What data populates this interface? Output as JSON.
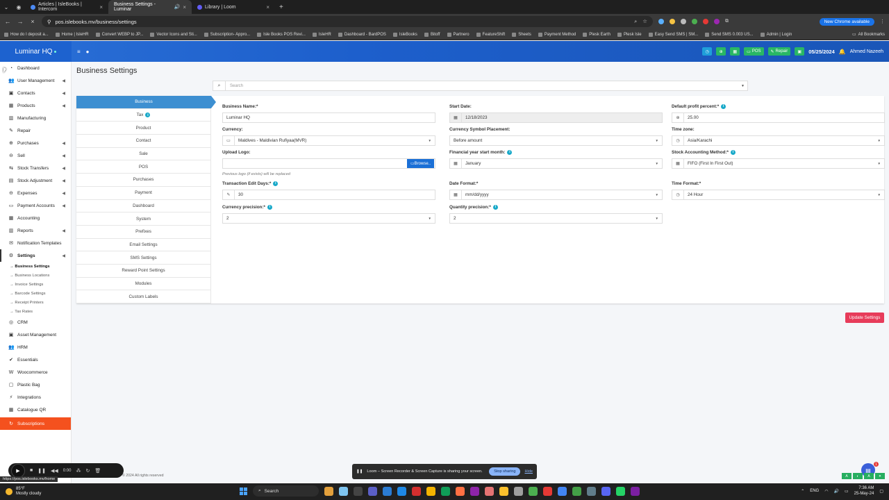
{
  "browser": {
    "tabs": [
      {
        "title": "Articles | IsleBooks | Intercom",
        "active": false
      },
      {
        "title": "Business Settings - Luminar",
        "active": true
      },
      {
        "title": "Library | Loom",
        "active": false
      }
    ],
    "url": "pos.islebooks.mv/business/settings",
    "new_chrome": "New Chrome available",
    "bookmarks": [
      "How do I deposit a...",
      "Home | IsleHR",
      "Convert WEBP to JP...",
      "Vector Icons and Sti...",
      "Subscription- Appro...",
      "Isle Books POS Revi...",
      "IsleHR",
      "Dashboard - BardPOS",
      "IsleBooks",
      "Bitoff",
      "Partnero",
      "FeatureShift",
      "Sheets",
      "Payment Method",
      "Plesk Earth",
      "Plesk Isle",
      "Easy Send SMS | SM...",
      "Send SMS 0.003 US...",
      "Admin | Login"
    ],
    "all_bookmarks": "All Bookmarks"
  },
  "header": {
    "brand": "Luminar HQ",
    "pos_label": "POS",
    "repair_label": "Repair",
    "date": "05/25/2024",
    "user": "Ahmed Nazeeh"
  },
  "sidebar": {
    "items": [
      {
        "label": "Dashboard",
        "icon": "dashboard-icon",
        "arrow": false
      },
      {
        "label": "User Management",
        "icon": "users-icon",
        "arrow": true
      },
      {
        "label": "Contacts",
        "icon": "contacts-icon",
        "arrow": true
      },
      {
        "label": "Products",
        "icon": "cubes-icon",
        "arrow": true
      },
      {
        "label": "Manufacturing",
        "icon": "industry-icon",
        "arrow": false
      },
      {
        "label": "Repair",
        "icon": "wrench-icon",
        "arrow": false
      },
      {
        "label": "Purchases",
        "icon": "purchase-icon",
        "arrow": true
      },
      {
        "label": "Sell",
        "icon": "sell-icon",
        "arrow": true
      },
      {
        "label": "Stock Transfers",
        "icon": "truck-icon",
        "arrow": true
      },
      {
        "label": "Stock Adjustment",
        "icon": "database-icon",
        "arrow": true
      },
      {
        "label": "Expenses",
        "icon": "minus-circle-icon",
        "arrow": true
      },
      {
        "label": "Payment Accounts",
        "icon": "money-icon",
        "arrow": true
      },
      {
        "label": "Accounting",
        "icon": "calculator-icon",
        "arrow": false
      },
      {
        "label": "Reports",
        "icon": "chart-icon",
        "arrow": true
      },
      {
        "label": "Notification Templates",
        "icon": "envelope-icon",
        "arrow": false
      },
      {
        "label": "Settings",
        "icon": "gear-icon",
        "arrow": true,
        "active": true
      }
    ],
    "settings_sub": [
      {
        "label": "→ Business Settings",
        "active": true
      },
      {
        "label": "→ Business Locations"
      },
      {
        "label": "→ Invoice Settings"
      },
      {
        "label": "→ Barcode Settings"
      },
      {
        "label": "→ Receipt Printers"
      },
      {
        "label": "→ Tax Rates"
      }
    ],
    "items_after": [
      {
        "label": "CRM",
        "icon": "crm-icon"
      },
      {
        "label": "Asset Management",
        "icon": "boxes-icon"
      },
      {
        "label": "HRM",
        "icon": "hrm-icon"
      },
      {
        "label": "Essentials",
        "icon": "check-circle-icon"
      },
      {
        "label": "Woocommerce",
        "icon": "woocommerce-icon"
      },
      {
        "label": "Plastic Bag",
        "icon": "bag-icon"
      },
      {
        "label": "Integrations",
        "icon": "plug-icon"
      },
      {
        "label": "Catalogue QR",
        "icon": "qr-icon"
      },
      {
        "label": "Subscriptions",
        "icon": "refresh-icon"
      }
    ]
  },
  "page": {
    "title": "Business Settings",
    "search_placeholder": "Search",
    "vertical_tabs": [
      "Business",
      "Tax",
      "Product",
      "Contact",
      "Sale",
      "POS",
      "Purchases",
      "Payment",
      "Dashboard",
      "System",
      "Prefixes",
      "Email Settings",
      "SMS Settings",
      "Reward Point Settings",
      "Modules",
      "Custom Labels"
    ],
    "form": {
      "business_name": {
        "label": "Business Name:*",
        "value": "Luminar HQ"
      },
      "start_date": {
        "label": "Start Date:",
        "value": "12/18/2023"
      },
      "profit_percent": {
        "label": "Default profit percent:*",
        "value": "25.00"
      },
      "currency": {
        "label": "Currency:",
        "value": "Maldives - Maldivian Rufiyaa(MVR)"
      },
      "symbol_placement": {
        "label": "Currency Symbol Placement:",
        "value": "Before amount"
      },
      "time_zone": {
        "label": "Time zone:",
        "value": "Asia/Karachi"
      },
      "upload_logo": {
        "label": "Upload Logo:",
        "browse": "Browse..",
        "help": "Previous logo (if exists) will be replaced"
      },
      "fy_start": {
        "label": "Financial year start month:",
        "value": "January"
      },
      "stock_method": {
        "label": "Stock Accounting Method:*",
        "value": "FIFO (First In First Out)"
      },
      "edit_days": {
        "label": "Transaction Edit Days:*",
        "value": "30"
      },
      "date_format": {
        "label": "Date Format:*",
        "value": "mm/dd/yyyy"
      },
      "time_format": {
        "label": "Time Format:*",
        "value": "24 Hour"
      },
      "currency_precision": {
        "label": "Currency precision:*",
        "value": "2"
      },
      "quantity_precision": {
        "label": "Quantity precision:*",
        "value": "2"
      }
    },
    "update_button": "Update Settings",
    "copyright": "© 2024 All rights reserved"
  },
  "overlays": {
    "loom_time": "0:00",
    "loom_msg": "Loom – Screen Recorder & Screen Capture is sharing your screen.",
    "stop_sharing": "Stop sharing",
    "hide": "Hide",
    "url_hint": "https://pos.islebooks.mv/home",
    "chat_badge": "1"
  },
  "taskbar": {
    "temp": "85°F",
    "weather": "Mostly cloudy",
    "search": "Search",
    "lang": "ENG",
    "time": "7:36 AM",
    "date": "25-May-24"
  }
}
